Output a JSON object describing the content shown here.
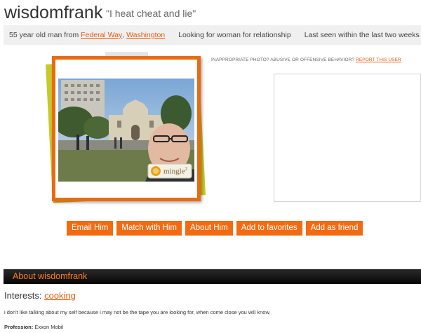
{
  "profile": {
    "username": "wisdomfrank",
    "tagline": "\"I heat cheat and lie\""
  },
  "info": {
    "age_prefix": "55 year old man from",
    "city": "Federal Way",
    "comma": ",",
    "state": "Washington",
    "looking_for": "Looking for woman for relationship",
    "last_seen": "Last seen within the last two weeks"
  },
  "photo": {
    "watermark": "mingle",
    "watermark_sup": "2"
  },
  "report": {
    "question": "INAPPROPRIATE PHOTO? ABUSIVE OR OFFENSIVE BEHAVIOR?",
    "link": "REPORT THIS USER"
  },
  "actions": {
    "email": "Email Him",
    "match": "Match with Him",
    "about": "About Him",
    "favorites": "Add to favorites",
    "friend": "Add as friend"
  },
  "about": {
    "header": "About wisdomfrank",
    "interests_label": "Interests:",
    "interests_value": "cooking",
    "description": "i don't like talking about my self because i may not be the tape you are looking for, when come close you will know.",
    "profession_label": "Profession:",
    "profession_value": "Exxon Mobil"
  },
  "colors": {
    "accent": "#f26b13",
    "frame": "#ea6a10",
    "back_card": "#c7c92b",
    "link": "#e85c0d"
  }
}
